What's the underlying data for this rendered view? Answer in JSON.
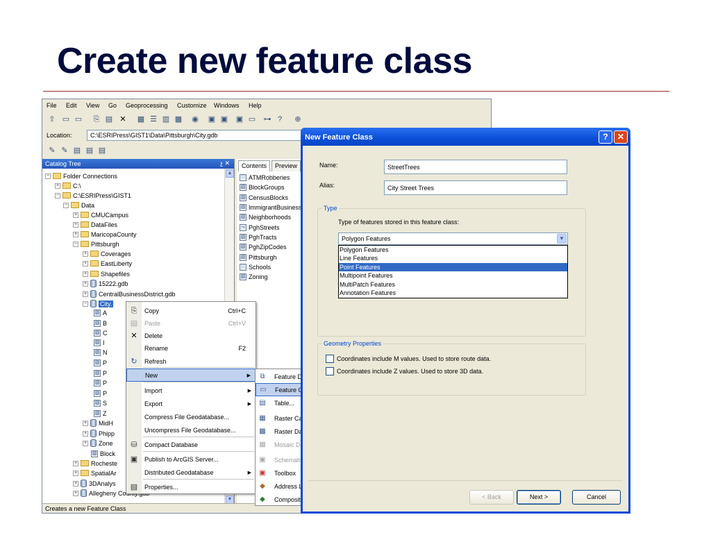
{
  "slide": {
    "title": "Create new feature class"
  },
  "catalog": {
    "menu": [
      "File",
      "Edit",
      "View",
      "Go",
      "Geoprocessing",
      "Customize",
      "Windows",
      "Help"
    ],
    "location_label": "Location:",
    "location_value": "C:\\ESRIPress\\GIST1\\Data\\Pittsburgh\\City.gdb",
    "tree_header": "Catalog Tree",
    "tree_pin": "չ ✕",
    "tree": [
      {
        "label": "Folder Connections",
        "exp": "−",
        "icon": "folder"
      },
      {
        "label": "C:\\",
        "exp": "+",
        "icon": "folder"
      },
      {
        "label": "C:\\ESRIPress\\GIST1",
        "exp": "−",
        "icon": "folder"
      },
      {
        "label": "Data",
        "exp": "−",
        "icon": "folder"
      },
      {
        "label": "CMUCampus",
        "exp": "+",
        "icon": "folder"
      },
      {
        "label": "DataFiles",
        "exp": "+",
        "icon": "folder"
      },
      {
        "label": "MaricopaCounty",
        "exp": "+",
        "icon": "folder"
      },
      {
        "label": "Pittsburgh",
        "exp": "−",
        "icon": "folder"
      },
      {
        "label": "Coverages",
        "exp": "+",
        "icon": "folder"
      },
      {
        "label": "EastLiberty",
        "exp": "+",
        "icon": "folder"
      },
      {
        "label": "Shapefiles",
        "exp": "+",
        "icon": "folder"
      },
      {
        "label": "15222.gdb",
        "exp": "+",
        "icon": "database"
      },
      {
        "label": "CentralBusinessDistrict.gdb",
        "exp": "+",
        "icon": "database"
      },
      {
        "label": "City.",
        "exp": "−",
        "icon": "database"
      },
      {
        "label": "A",
        "exp": "",
        "icon": "feature-class"
      },
      {
        "label": "B",
        "exp": "",
        "icon": "feature-class"
      },
      {
        "label": "C",
        "exp": "",
        "icon": "feature-class"
      },
      {
        "label": "I",
        "exp": "",
        "icon": "feature-class"
      },
      {
        "label": "N",
        "exp": "",
        "icon": "feature-class"
      },
      {
        "label": "P",
        "exp": "",
        "icon": "feature-class"
      },
      {
        "label": "P",
        "exp": "",
        "icon": "feature-class"
      },
      {
        "label": "P",
        "exp": "",
        "icon": "feature-class"
      },
      {
        "label": "P",
        "exp": "",
        "icon": "feature-class"
      },
      {
        "label": "S",
        "exp": "",
        "icon": "feature-class"
      },
      {
        "label": "Z",
        "exp": "",
        "icon": "feature-class"
      },
      {
        "label": "MidH",
        "exp": "+",
        "icon": "database"
      },
      {
        "label": "Phipp",
        "exp": "+",
        "icon": "database"
      },
      {
        "label": "Zone",
        "exp": "+",
        "icon": "database"
      },
      {
        "label": "Block",
        "exp": "",
        "icon": "feature-class"
      },
      {
        "label": "Rocheste",
        "exp": "+",
        "icon": "folder"
      },
      {
        "label": "SpatialAr",
        "exp": "+",
        "icon": "folder"
      },
      {
        "label": "3DAnalys",
        "exp": "+",
        "icon": "database"
      },
      {
        "label": "Allegheny County.gdb",
        "exp": "+",
        "icon": "database"
      }
    ],
    "tabs": {
      "contents": "Contents",
      "preview": "Preview"
    },
    "contents": [
      {
        "label": "ATMRobberies",
        "icon": "point-fc-icon",
        "glyph": "∷"
      },
      {
        "label": "BlockGroups",
        "icon": "polygon-fc-icon",
        "glyph": "▧"
      },
      {
        "label": "CensusBlocks",
        "icon": "polygon-fc-icon",
        "glyph": "▧"
      },
      {
        "label": "ImmigrantBusiness",
        "icon": "table-icon",
        "glyph": "▤"
      },
      {
        "label": "Neighborhoods",
        "icon": "polygon-fc-icon",
        "glyph": "▧"
      },
      {
        "label": "PghStreets",
        "icon": "line-fc-icon",
        "glyph": "⤳"
      },
      {
        "label": "PghTracts",
        "icon": "polygon-fc-icon",
        "glyph": "▧"
      },
      {
        "label": "PghZipCodes",
        "icon": "polygon-fc-icon",
        "glyph": "▧"
      },
      {
        "label": "Pittsburgh",
        "icon": "polygon-fc-icon",
        "glyph": "▧"
      },
      {
        "label": "Schools",
        "icon": "point-fc-icon",
        "glyph": "∷"
      },
      {
        "label": "Zoning",
        "icon": "polygon-fc-icon",
        "glyph": "▧"
      }
    ],
    "status": "Creates a new Feature Class"
  },
  "context_menu": {
    "copy": "Copy",
    "copy_sc": "Ctrl+C",
    "paste": "Paste",
    "paste_sc": "Ctrl+V",
    "delete": "Delete",
    "rename": "Rename",
    "rename_sc": "F2",
    "refresh": "Refresh",
    "new": "New",
    "import": "Import",
    "export": "Export",
    "compress": "Compress File Geodatabase...",
    "uncompress": "Uncompress File Geodatabase...",
    "compact": "Compact Database",
    "publish": "Publish to ArcGIS Server...",
    "distributed": "Distributed Geodatabase",
    "properties": "Properties..."
  },
  "submenu": {
    "feature_dataset": "Feature D",
    "feature_class": "Feature C",
    "table": "Table...",
    "raster_catalog": "Raster Ca",
    "raster_dataset": "Raster Da",
    "mosaic_dataset": "Mosaic Da",
    "schematic": "Schemati",
    "toolbox": "Toolbox",
    "address_locator": "Address L",
    "composite": "Composit"
  },
  "dialog": {
    "title": "New Feature Class",
    "help_btn": "?",
    "close_btn": "✕",
    "name_label": "Name:",
    "name_value": "StreetTrees",
    "alias_label": "Alias:",
    "alias_value": "City Street Trees",
    "type_legend": "Type",
    "type_prompt": "Type of features stored in this feature class:",
    "type_selected": "Polygon Features",
    "type_options": [
      "Polygon Features",
      "Line Features",
      "Point Features",
      "Multipoint Features",
      "MultiPatch Features",
      "Annotation Features"
    ],
    "type_highlighted": "Point Features",
    "geometry_legend": "Geometry Properties",
    "m_values": "Coordinates include M values. Used to store route data.",
    "z_values": "Coordinates include Z values. Used to store 3D data.",
    "back": "< Back",
    "next": "Next >",
    "cancel": "Cancel"
  }
}
